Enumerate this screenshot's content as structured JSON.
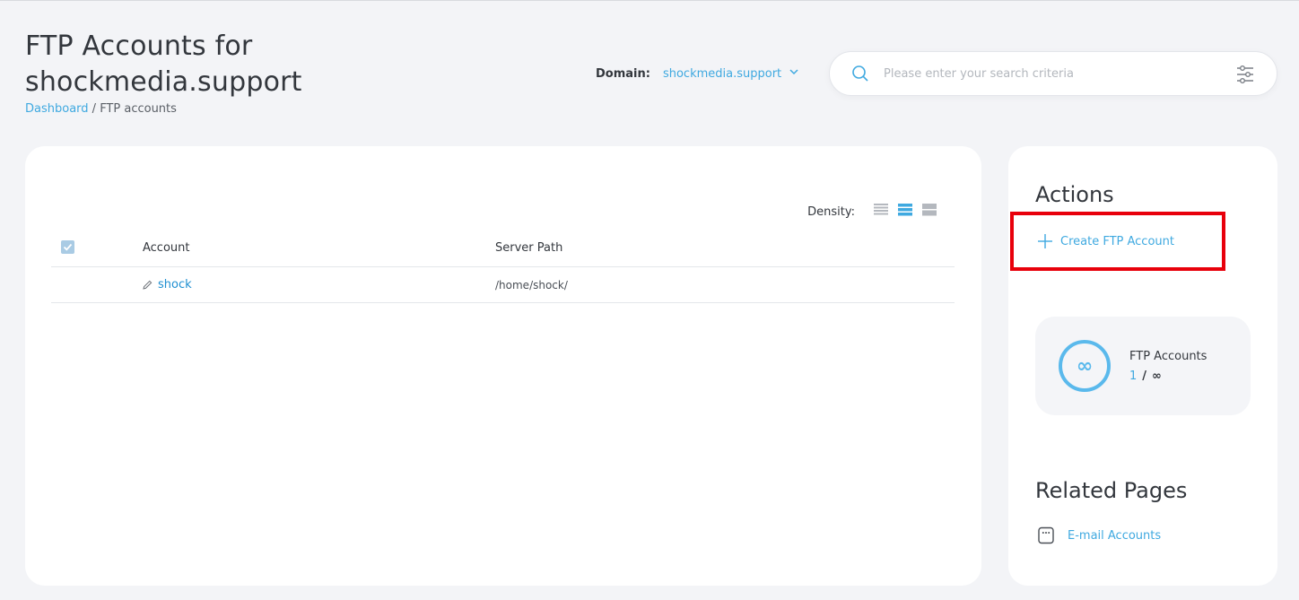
{
  "header": {
    "title": "FTP Accounts for shockmedia.support",
    "breadcrumb": {
      "home": "Dashboard",
      "separator": " / ",
      "current": "FTP accounts"
    }
  },
  "domain_selector": {
    "label": "Domain:",
    "value": "shockmedia.support"
  },
  "search": {
    "placeholder": "Please enter your search criteria",
    "value": ""
  },
  "table": {
    "density_label": "Density:",
    "columns": [
      "Account",
      "Server Path"
    ],
    "rows": [
      {
        "account": "shock",
        "server_path": "/home/shock/"
      }
    ]
  },
  "sidebar": {
    "actions_title": "Actions",
    "create_label": "Create FTP Account",
    "stat": {
      "label": "FTP Accounts",
      "used": "1",
      "separator": "/",
      "max": "∞",
      "ring_symbol": "∞"
    },
    "related_title": "Related Pages",
    "related_links": [
      {
        "label": "E-mail Accounts"
      }
    ]
  },
  "colors": {
    "accent": "#3fa9e0",
    "highlight_border": "#e8000b",
    "background": "#f3f4f7"
  }
}
